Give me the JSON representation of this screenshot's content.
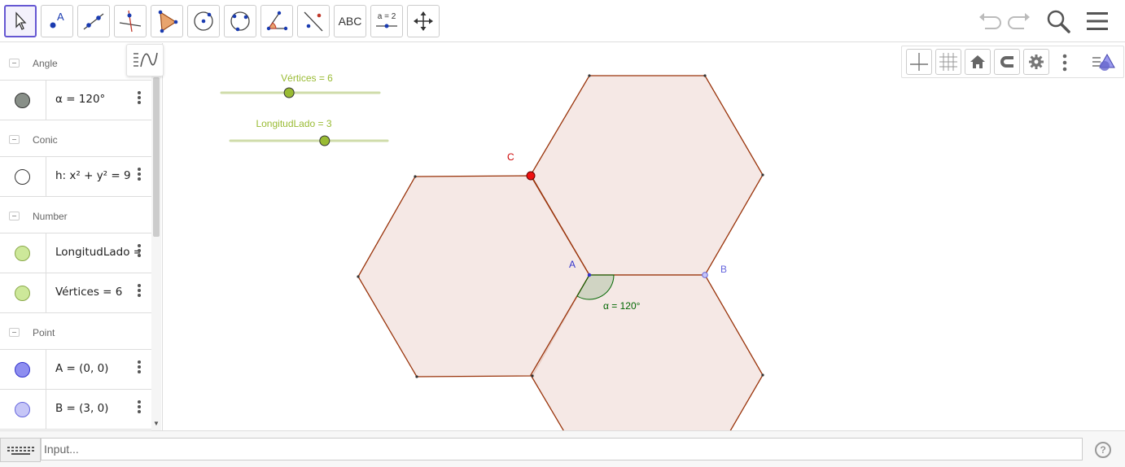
{
  "toolbar": {
    "tools": [
      {
        "id": "move",
        "icon": "move-arrow-icon"
      },
      {
        "id": "point",
        "icon": "point-icon",
        "letter": "A"
      },
      {
        "id": "line",
        "icon": "line-icon"
      },
      {
        "id": "perpendicular",
        "icon": "perpendicular-line-icon"
      },
      {
        "id": "polygon",
        "icon": "polygon-icon"
      },
      {
        "id": "circle",
        "icon": "circle-center-point-icon"
      },
      {
        "id": "circle3",
        "icon": "circle-three-points-icon"
      },
      {
        "id": "angle",
        "icon": "angle-icon"
      },
      {
        "id": "reflect",
        "icon": "reflect-about-line-icon"
      },
      {
        "id": "text",
        "label": "ABC"
      },
      {
        "id": "slider",
        "label": "a = 2"
      },
      {
        "id": "move-graphics",
        "icon": "move-graphics-view-icon"
      }
    ]
  },
  "algebra": {
    "categories": [
      {
        "label": "Angle",
        "items": [
          {
            "expr": "α = 120°",
            "color": "#888f88"
          }
        ]
      },
      {
        "label": "Conic",
        "items": [
          {
            "expr": "h: x² + y² = 9",
            "color": "#ffffff"
          }
        ]
      },
      {
        "label": "Number",
        "items": [
          {
            "expr": "LongitudLado = 3",
            "color": "#cde89a"
          },
          {
            "expr": "Vértices = 6",
            "color": "#cde89a"
          }
        ]
      },
      {
        "label": "Point",
        "items": [
          {
            "expr": "A = (0, 0)",
            "color": "#8e8ef0"
          },
          {
            "expr": "B = (3, 0)",
            "color": "#c6c6f7"
          }
        ]
      }
    ]
  },
  "graphics": {
    "sliders": [
      {
        "label": "Vértices = 6",
        "value": 6,
        "min": 3,
        "max": 10
      },
      {
        "label": "LongitudLado = 3",
        "value": 3,
        "min": 0,
        "max": 5
      }
    ],
    "points": {
      "A": "A",
      "B": "B",
      "C": "C"
    },
    "angle_label": "α = 120°",
    "colors": {
      "hexagon_fill": "#f3e4e0",
      "hexagon_stroke": "#99330a",
      "point_A": "#3333cc",
      "point_B": "#6666dd",
      "point_C": "#cc0000",
      "slider": "#99bb33",
      "angle": "#006600"
    }
  },
  "inputbar": {
    "placeholder": "Input..."
  },
  "help": "?"
}
